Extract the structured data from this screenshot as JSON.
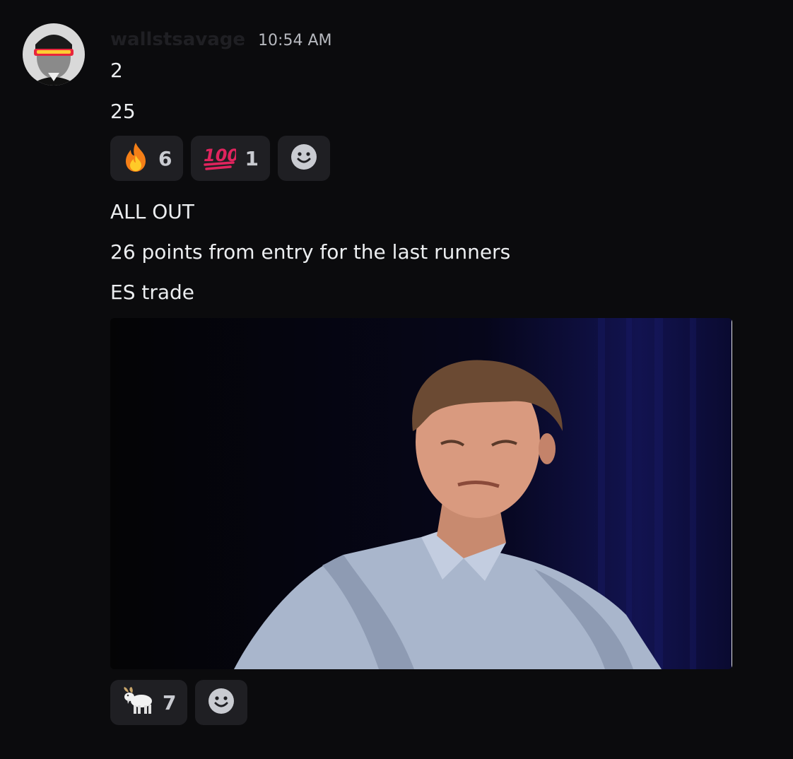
{
  "message": {
    "username": "wallstsavage",
    "timestamp": "10:54 AM",
    "lines": [
      "2",
      "25"
    ],
    "reactions_1": [
      {
        "emoji": "fire-icon",
        "count": "6"
      },
      {
        "emoji": "hundred-points-icon",
        "count": "1"
      }
    ],
    "lines_2": [
      "ALL OUT",
      "26 points from entry for the last runners",
      "ES trade"
    ],
    "attachment": {
      "type": "gif",
      "description": "reaction gif"
    },
    "reactions_2": [
      {
        "emoji": "goat-icon",
        "count": "7"
      }
    ]
  },
  "colors": {
    "background": "#0b0b0d",
    "reaction_bg": "#1f1f23",
    "text": "#eceef0",
    "timestamp": "#b7b9bf"
  }
}
